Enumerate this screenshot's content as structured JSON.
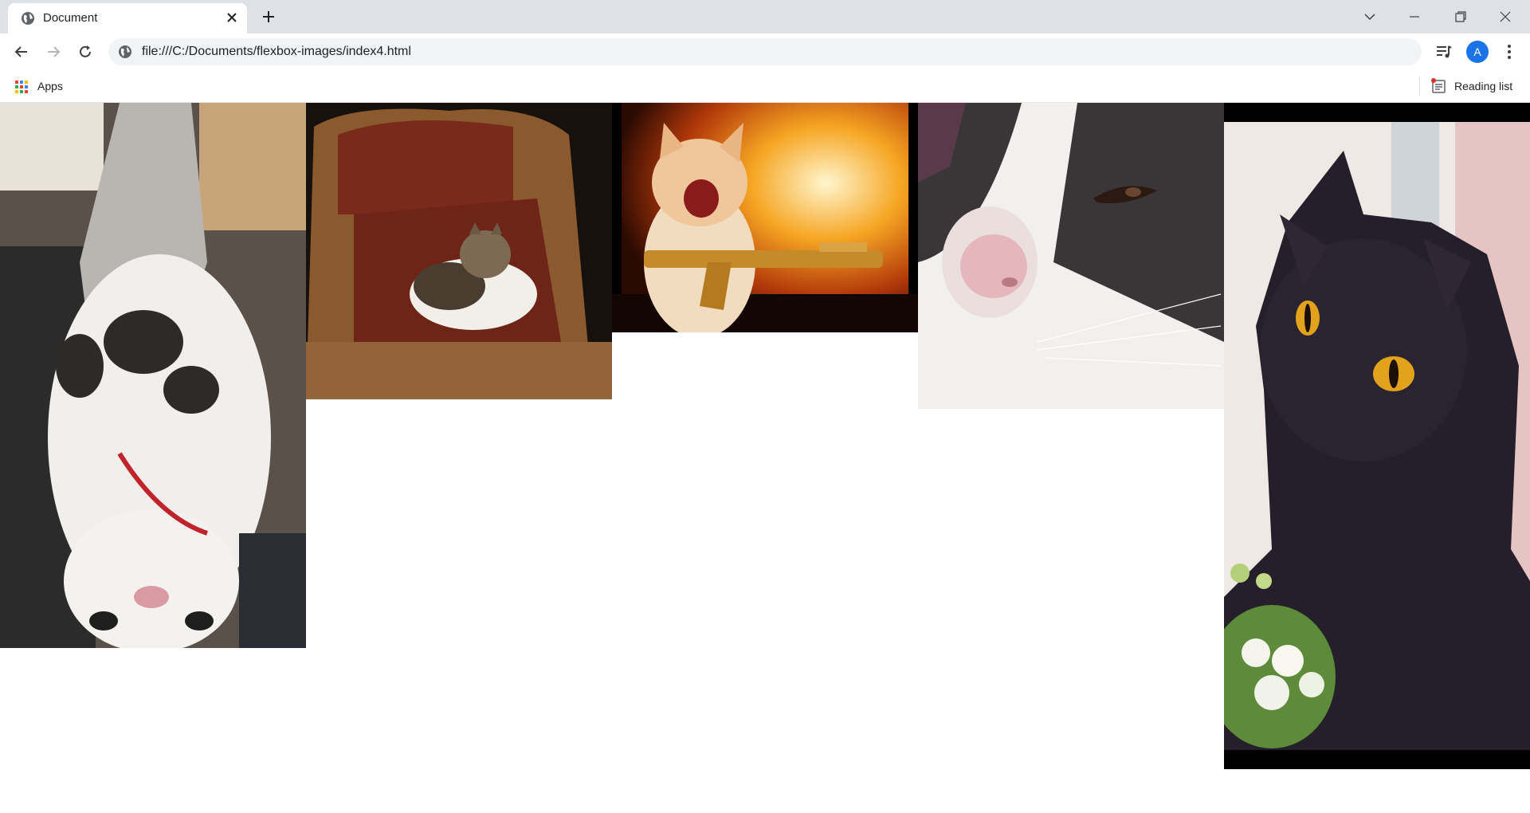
{
  "browser": {
    "tab": {
      "title": "Document",
      "favicon": "globe-icon",
      "close_icon": "close-icon"
    },
    "new_tab_icon": "plus-icon",
    "window_controls": [
      "chevron-down-icon",
      "minimize-icon",
      "restore-icon",
      "close-icon"
    ],
    "nav": {
      "back": "arrow-left-icon",
      "forward": "arrow-right-icon",
      "reload": "reload-icon"
    },
    "address_bar": {
      "icon": "info-globe-icon",
      "url": "file:///C:/Documents/flexbox-images/index4.html"
    },
    "profile_initial": "A",
    "accent_color": "#1a73e8"
  },
  "bookmarks_bar": {
    "apps_label": "Apps",
    "reading_list_label": "Reading list"
  },
  "page": {
    "images": [
      {
        "subject": "white-and-black cat lying upside down on a lap, red collar"
      },
      {
        "subject": "tabby-and-white cat sitting in a wicker armchair with red cushions"
      },
      {
        "subject": "ginger cat yelling and holding a golden rifle in front of an explosion"
      },
      {
        "subject": "close-up of a black-and-white cat's face with pink nose"
      },
      {
        "subject": "black cat with orange eyes by a window with white flowers"
      }
    ]
  }
}
